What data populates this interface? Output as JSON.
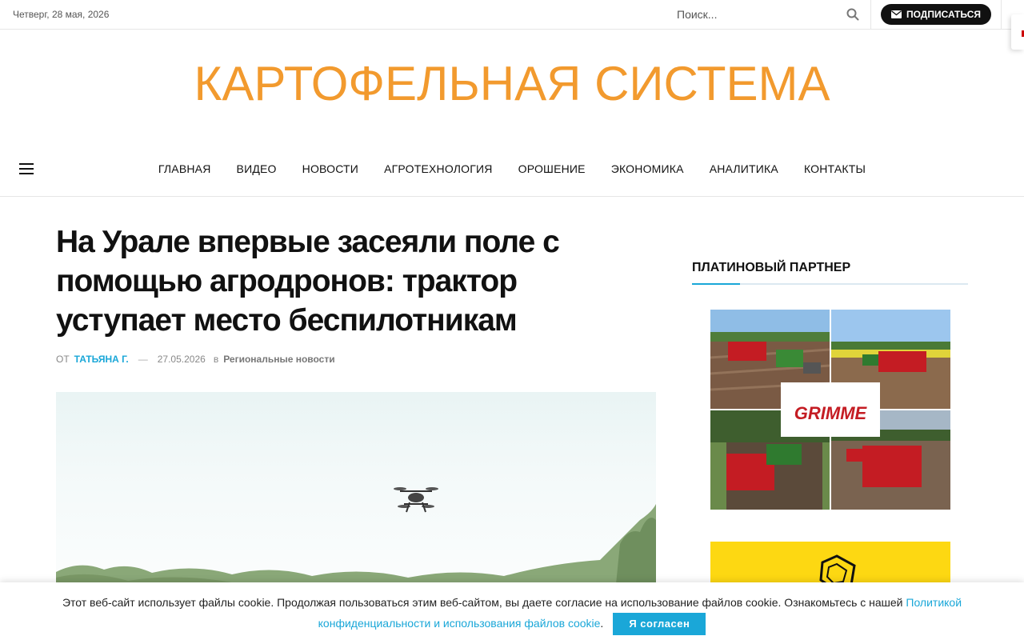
{
  "topbar": {
    "date": "Четверг, 28 мая, 2026",
    "search_placeholder": "Поиск...",
    "subscribe_label": "ПОДПИСАТЬСЯ"
  },
  "site": {
    "logo": "КАРТОФЕЛЬНАЯ СИСТЕМА"
  },
  "nav": {
    "items": [
      "ГЛАВНАЯ",
      "ВИДЕО",
      "НОВОСТИ",
      "АГРОТЕХНОЛОГИЯ",
      "ОРОШЕНИЕ",
      "ЭКОНОМИКА",
      "АНАЛИТИКА",
      "КОНТАКТЫ"
    ]
  },
  "article": {
    "title": "На Урале впервые засеяли поле с помощью агродронов: трактор уступает место беспилотникам",
    "by": "ОТ",
    "author": "ТАТЬЯНА Г.",
    "dash": "—",
    "date": "27.05.2026",
    "in": "в",
    "category": "Региональные новости"
  },
  "sidebar": {
    "title": "ПЛАТИНОВЫЙ ПАРТНЕР",
    "banner_brand": "GRIMME"
  },
  "cookie": {
    "text": "Этот веб-сайт использует файлы cookie. Продолжая пользоваться этим веб-сайтом, вы даете согласие на использование файлов cookie. Ознакомьтесь с нашей ",
    "link": "Политикой конфиденциальности и использования файлов cookie",
    "period": ".",
    "accept": "Я согласен"
  },
  "colors": {
    "logo": "#f29a2e",
    "accent": "#1aa7d8",
    "banner_red": "#c41c23",
    "banner_yellow": "#fdd812"
  }
}
